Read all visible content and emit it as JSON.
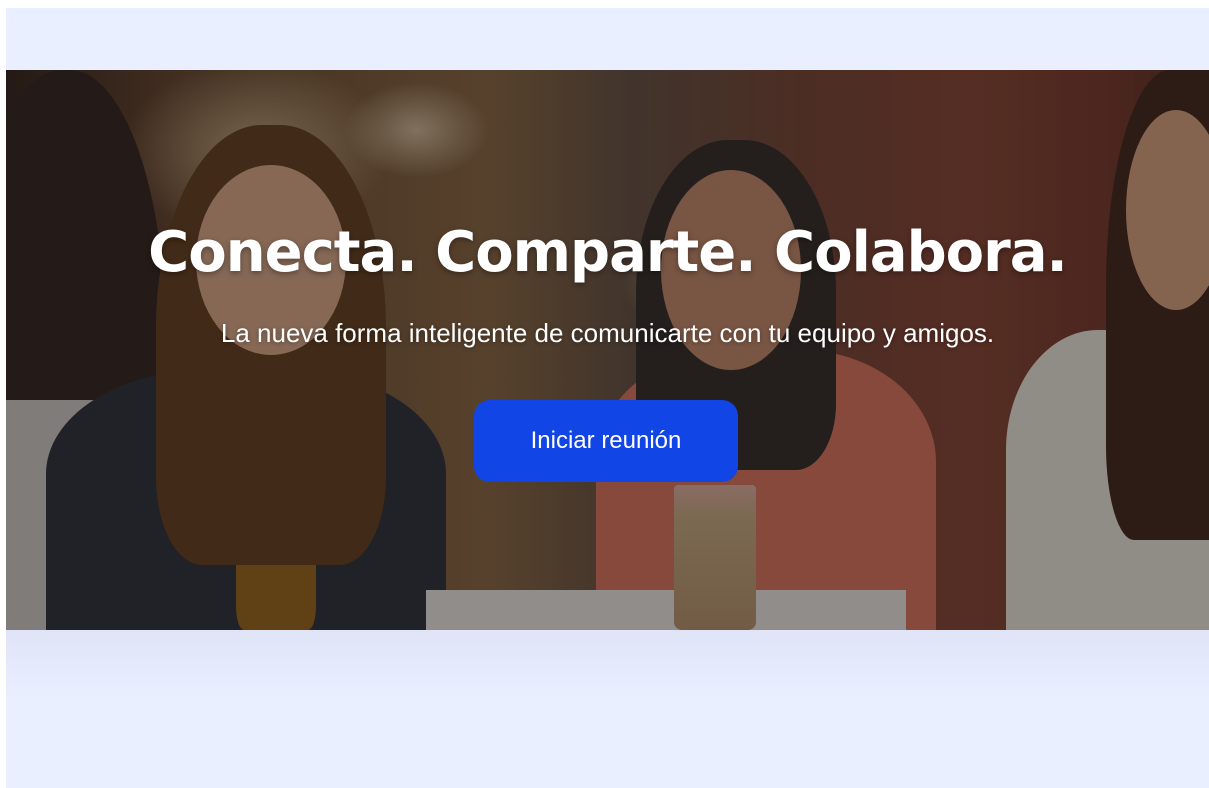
{
  "hero": {
    "headline": "Conecta. Comparte. Colabora.",
    "subline": "La nueva forma inteligente de comunicarte con tu equipo y amigos.",
    "cta_label": "Iniciar reunión"
  },
  "colors": {
    "background": "#e9efff",
    "cta": "#1145e6",
    "text": "#ffffff"
  }
}
